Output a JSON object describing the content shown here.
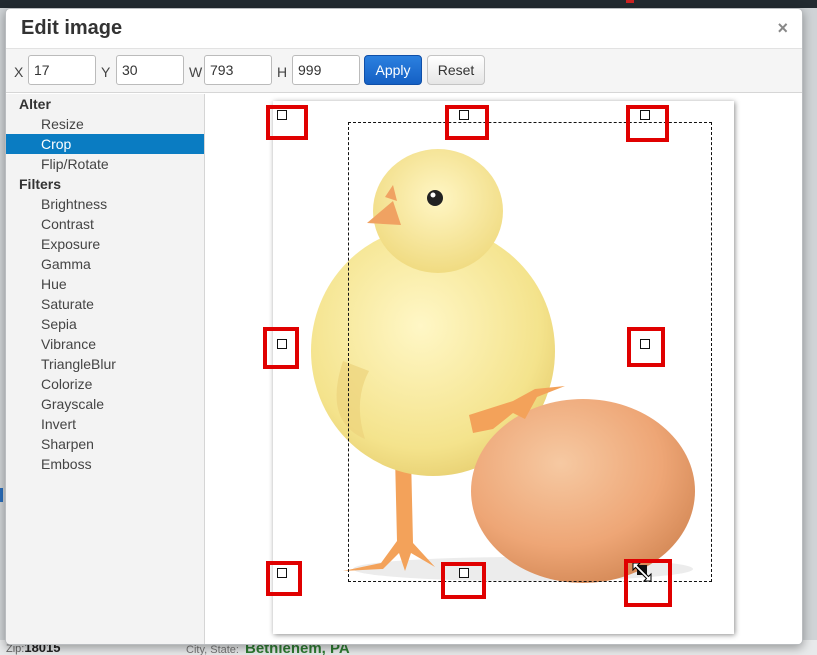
{
  "dialog": {
    "title": "Edit image",
    "close_glyph": "×"
  },
  "toolbar": {
    "x_label": "X",
    "x_value": "17",
    "y_label": "Y",
    "y_value": "30",
    "w_label": "W",
    "w_value": "793",
    "h_label": "H",
    "h_value": "999",
    "apply_label": "Apply",
    "reset_label": "Reset"
  },
  "sidebar": {
    "groups": [
      {
        "label": "Alter",
        "items": [
          "Resize",
          "Crop",
          "Flip/Rotate"
        ]
      },
      {
        "label": "Filters",
        "items": [
          "Brightness",
          "Contrast",
          "Exposure",
          "Gamma",
          "Hue",
          "Saturate",
          "Sepia",
          "Vibrance",
          "TriangleBlur",
          "Colorize",
          "Grayscale",
          "Invert",
          "Sharpen",
          "Emboss"
        ]
      }
    ],
    "active_item": "Crop"
  },
  "background": {
    "zip_label": "Zip:",
    "zip_value": "18015",
    "city_label": "City, State:",
    "city_value": "Bethlehem, PA"
  },
  "colors": {
    "accent": "#0a7cc2",
    "apply_button": "#1a6fd3",
    "highlight": "#e00000"
  },
  "icons": {
    "close": "close-icon",
    "cursor": "resize-cursor-icon"
  }
}
